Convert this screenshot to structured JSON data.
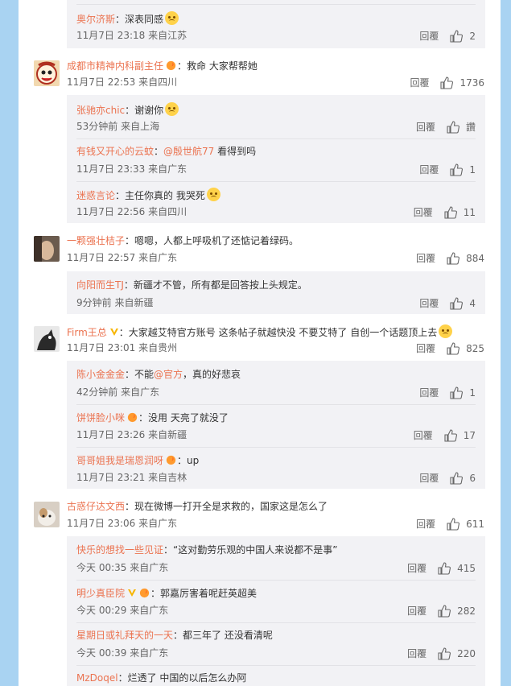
{
  "top_reply": {
    "name": "奥尔济斯",
    "text": "：深表同感",
    "time": "11月7日 23:18 来自江苏",
    "reply": "回覆",
    "likes": "2"
  },
  "comments": [
    {
      "name": "成都市精神内科副主任",
      "text": "：救命 大家帮帮她",
      "time": "11月7日 22:53 来自四川",
      "reply": "回覆",
      "likes": "1736",
      "replies": [
        {
          "name": "张驰亦chic",
          "text": "：谢谢你",
          "time": "53分钟前 来自上海",
          "reply": "回覆",
          "likes": "讚"
        },
        {
          "name": "有钱又开心的云蚊",
          "at": "@殷世航77",
          "text": " 看得到吗",
          "time": "11月7日 23:33 来自广东",
          "reply": "回覆",
          "likes": "1"
        },
        {
          "name": "迷惑言论",
          "text": "：主任你真的 我哭死",
          "time": "11月7日 22:56 来自四川",
          "reply": "回覆",
          "likes": "11"
        }
      ]
    },
    {
      "name": "一颗强壮桔子",
      "text": "：嗯嗯，人都上呼吸机了还惦记着绿码。",
      "time": "11月7日 22:57 来自广东",
      "reply": "回覆",
      "likes": "884",
      "replies": [
        {
          "name": "向阳而生TJ",
          "text": "：新疆才不管，所有都是回答按上头规定。",
          "time": "9分钟前 来自新疆",
          "reply": "回覆",
          "likes": "4"
        }
      ]
    },
    {
      "name": "Firm王总",
      "text": "：大家越艾特官方账号 这条帖子就越快没 不要艾特了 自创一个话题顶上去",
      "time": "11月7日 23:01 来自贵州",
      "reply": "回覆",
      "likes": "825",
      "replies": [
        {
          "name": "陈小金金金",
          "text": "：不能",
          "at": "@官方",
          "text2": "，真的好悲哀",
          "time": "42分钟前 来自广东",
          "reply": "回覆",
          "likes": "1"
        },
        {
          "name": "饼饼脸小咪",
          "text": "：没用 天亮了就没了",
          "time": "11月7日 23:26 来自新疆",
          "reply": "回覆",
          "likes": "17"
        },
        {
          "name": "哥哥姐我是瑞恩润呀",
          "text": "：up",
          "time": "11月7日 23:21 来自吉林",
          "reply": "回覆",
          "likes": "6"
        }
      ]
    },
    {
      "name": "古惑仔达文西",
      "text": "：现在微博一打开全是求救的，国家这是怎么了",
      "time": "11月7日 23:06 来自广东",
      "reply": "回覆",
      "likes": "611",
      "replies": [
        {
          "name": "快乐的想找一些见证",
          "text": "：“这对勤劳乐观的中国人来说都不是事”",
          "time": "今天 00:35 来自广东",
          "reply": "回覆",
          "likes": "415"
        },
        {
          "name": "明少真臣院",
          "text": "：郭嘉厉害着呢赶英超美",
          "time": "今天 00:29 来自广东",
          "reply": "回覆",
          "likes": "282"
        },
        {
          "name": "星期日或礼拜天的一天",
          "text": "：都三年了 还没看清呢",
          "time": "今天 00:39 来自广东",
          "reply": "回覆",
          "likes": "220"
        },
        {
          "name": "MzDoqel",
          "text": "：烂透了 中国的以后怎么办阿",
          "time": "",
          "reply": "",
          "likes": ""
        }
      ]
    }
  ]
}
